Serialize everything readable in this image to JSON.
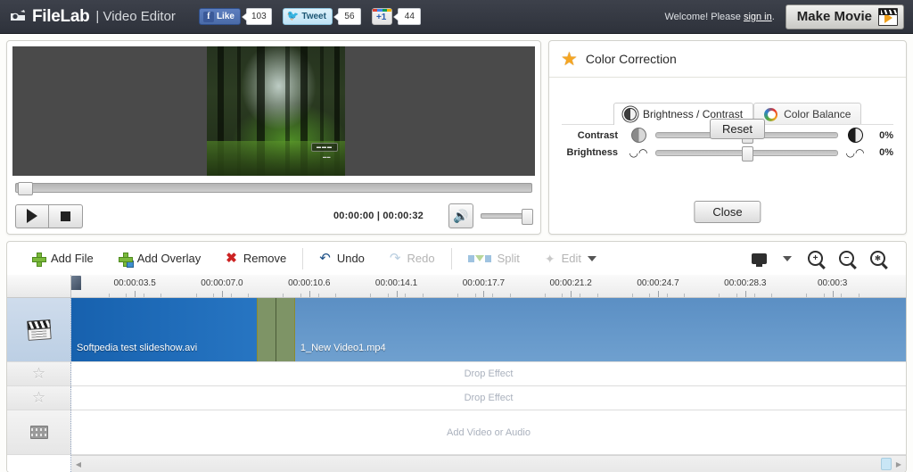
{
  "header": {
    "brand": "FileLab",
    "brand_sub": "| Video Editor",
    "logo_icon": "filelab-logo-icon",
    "social": [
      {
        "id": "facebook",
        "label": "Like",
        "count": "103",
        "icon": "facebook-icon"
      },
      {
        "id": "twitter",
        "label": "Tweet",
        "count": "56",
        "icon": "twitter-bird-icon"
      },
      {
        "id": "gplus",
        "label": "+1",
        "count": "44",
        "icon": "google-plus-icon"
      }
    ],
    "welcome_prefix": "Welcome! Please ",
    "welcome_link": "sign in",
    "welcome_suffix": ".",
    "make_movie_label": "Make Movie",
    "make_movie_icon": "clapperboard-play-icon"
  },
  "player": {
    "seek_position_pct": 0,
    "time_display": "00:00:00 | 00:00:32",
    "current_time": "00:00:00",
    "duration": "00:00:32",
    "play_icon": "play-icon",
    "stop_icon": "stop-icon",
    "volume_icon": "speaker-volume-icon",
    "volume_pct": 100,
    "preview_caption": "forest-video-frame"
  },
  "color_correction": {
    "title": "Color Correction",
    "title_icon": "star-icon",
    "tabs": [
      {
        "id": "brightness-contrast",
        "label": "Brightness / Contrast",
        "icon": "brightness-contrast-icon",
        "active": true
      },
      {
        "id": "color-balance",
        "label": "Color Balance",
        "icon": "color-wheel-icon",
        "active": false
      }
    ],
    "sliders": [
      {
        "id": "contrast",
        "label": "Contrast",
        "value": "0%",
        "knob_pct": 50,
        "left_icon": "contrast-low-icon",
        "right_icon": "contrast-high-icon"
      },
      {
        "id": "brightness",
        "label": "Brightness",
        "value": "0%",
        "knob_pct": 50,
        "left_icon": "brightness-low-icon",
        "right_icon": "brightness-high-icon"
      }
    ],
    "reset_label": "Reset",
    "close_label": "Close"
  },
  "toolbar": {
    "items": [
      {
        "id": "add-file",
        "label": "Add File",
        "icon": "plus-green-icon",
        "disabled": false
      },
      {
        "id": "add-overlay",
        "label": "Add Overlay",
        "icon": "plus-overlay-icon",
        "disabled": false
      },
      {
        "id": "remove",
        "label": "Remove",
        "icon": "x-red-icon",
        "disabled": false
      },
      {
        "id": "undo",
        "label": "Undo",
        "icon": "undo-arrow-icon",
        "disabled": false
      },
      {
        "id": "redo",
        "label": "Redo",
        "icon": "redo-arrow-icon",
        "disabled": true
      },
      {
        "id": "split",
        "label": "Split",
        "icon": "split-icon",
        "disabled": true
      },
      {
        "id": "edit",
        "label": "Edit",
        "icon": "magic-wand-icon",
        "disabled": true
      }
    ],
    "right_icons": [
      {
        "id": "preview-monitor",
        "icon": "monitor-icon"
      },
      {
        "id": "preview-dropdown",
        "icon": "chevron-down-icon"
      },
      {
        "id": "zoom-in",
        "icon": "zoom-in-icon",
        "glyph": "+"
      },
      {
        "id": "zoom-out",
        "icon": "zoom-out-icon",
        "glyph": "−"
      },
      {
        "id": "zoom-fit",
        "icon": "zoom-fit-icon",
        "glyph": "✥"
      }
    ]
  },
  "timeline": {
    "ruler_labels": [
      "00:00:03.5",
      "00:00:07.0",
      "00:00:10.6",
      "00:00:14.1",
      "00:00:17.7",
      "00:00:21.2",
      "00:00:24.7",
      "00:00:28.3",
      "00:00:3"
    ],
    "playhead_pct": 0,
    "tracks": [
      {
        "id": "video-track",
        "head_icon": "clapperboard-icon",
        "clips": [
          {
            "id": "clip-1",
            "label": "Softpedia test slideshow.avi",
            "left_pct": 0,
            "width_pct": 26.8
          },
          {
            "id": "clip-2",
            "label": "1_New Video1.mp4",
            "left_pct": 26.8,
            "width_pct": 73.2
          }
        ],
        "transition": {
          "id": "transition-1",
          "left_pct": 22.2,
          "width_pct": 4.6
        }
      },
      {
        "id": "effect-track-1",
        "head_icon": "star-outline-icon",
        "placeholder": "Drop Effect"
      },
      {
        "id": "effect-track-2",
        "head_icon": "star-outline-icon",
        "placeholder": "Drop Effect"
      },
      {
        "id": "media-track",
        "head_icon": "film-strip-icon",
        "placeholder": "Add Video or Audio"
      }
    ],
    "scroll_left_icon": "scroll-left-arrow-icon",
    "scroll_right_icon": "scroll-right-arrow-icon"
  },
  "colors": {
    "header_bg": "#343943",
    "accent_orange": "#f5a623",
    "clip_blue": "#2a79c6",
    "transition_green": "#7e9466",
    "disabled_grey": "#b4b4b4"
  }
}
